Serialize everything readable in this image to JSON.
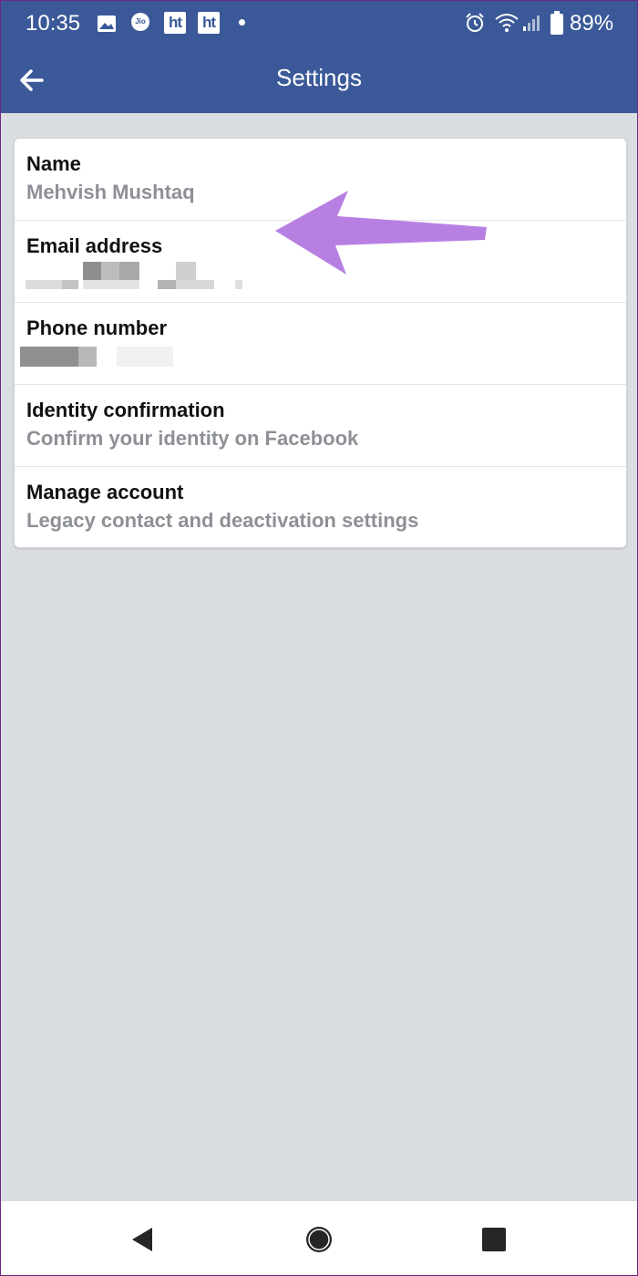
{
  "status_bar": {
    "time": "10:35",
    "battery": "89%",
    "left_icons": [
      "image-icon",
      "jio-icon",
      "ht-icon",
      "ht-icon",
      "dot-icon"
    ],
    "right_icons": [
      "alarm-icon",
      "wifi-icon",
      "signal-icon",
      "battery-icon"
    ],
    "ht_label": "ht",
    "jio_label": "Jio"
  },
  "topbar": {
    "title": "Settings",
    "back_icon": "back-arrow-icon",
    "background": "#3b5998"
  },
  "settings": {
    "items": [
      {
        "title": "Name",
        "subtitle": "Mehvish Mushtaq"
      },
      {
        "title": "Email address",
        "subtitle": ""
      },
      {
        "title": "Phone number",
        "subtitle": ""
      },
      {
        "title": "Identity confirmation",
        "subtitle": "Confirm your identity on Facebook"
      },
      {
        "title": "Manage account",
        "subtitle": "Legacy contact and deactivation settings"
      }
    ]
  },
  "annotation": {
    "icon": "arrow-annotation-icon",
    "color": "#b87fe3"
  },
  "navbar": {
    "icons": [
      "nav-back-icon",
      "nav-home-icon",
      "nav-recents-icon"
    ]
  }
}
